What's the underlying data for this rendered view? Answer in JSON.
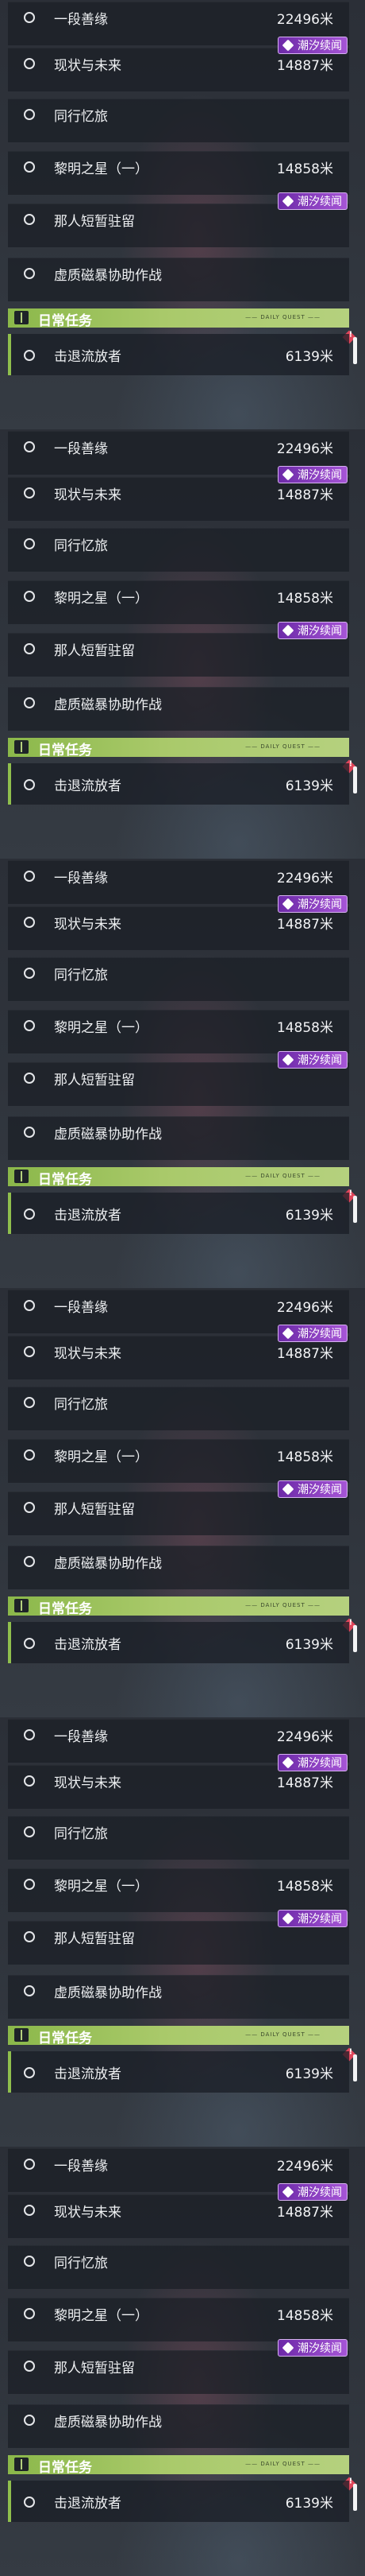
{
  "quests": [
    {
      "label": "一段善缘",
      "distance": "22496米"
    },
    {
      "label": "现状与未来",
      "distance": "14887米",
      "badge": "潮汐续闻"
    },
    {
      "label": "同行忆旅",
      "distance": ""
    },
    {
      "label": "黎明之星（一）",
      "distance": "14858米"
    },
    {
      "label": "那人短暂驻留",
      "distance": "",
      "badge": "潮汐续闻"
    },
    {
      "label": "虚质磁暴协助作战",
      "distance": ""
    }
  ],
  "daily": {
    "title": "日常任务",
    "subtitle": "—— DAILY QUEST ——",
    "task_label": "击退流放者",
    "task_distance": "6139米"
  },
  "colors": {
    "accent_green": "#8bb84a",
    "badge_purple": "#8a3fc2",
    "warning_red": "#e0455a"
  },
  "icons": [
    "radio-circle-icon",
    "book-icon",
    "wave-badge-icon",
    "warning-diamond-icon"
  ],
  "panels": 6
}
